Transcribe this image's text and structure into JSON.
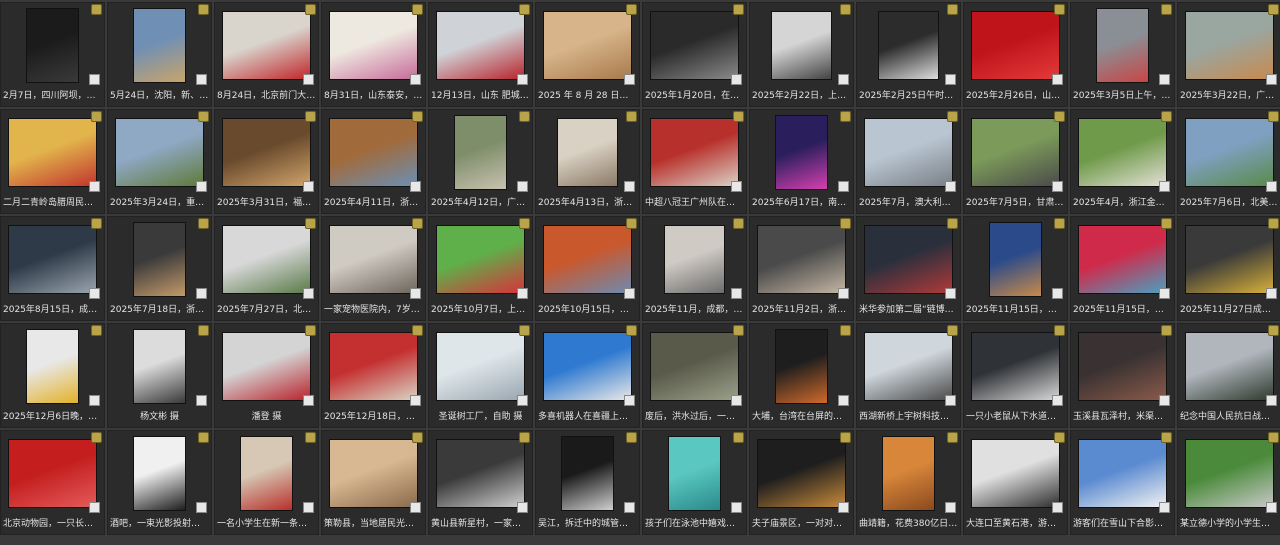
{
  "photos": [
    {
      "caption": "2月7日，四川阿坝，连绵暖…",
      "colors": [
        "#1b1b1b",
        "#3a3a3a"
      ],
      "shape": "portrait"
    },
    {
      "caption": "5月24日，沈阳，新、旧城市…",
      "colors": [
        "#6f8fb5",
        "#c9a46a"
      ],
      "shape": "portrait"
    },
    {
      "caption": "8月24日，北京前门大街，游…",
      "colors": [
        "#d9d4cc",
        "#c0262b"
      ],
      "shape": "wide"
    },
    {
      "caption": "8月31日，山东泰安，一年级…",
      "colors": [
        "#eee9e0",
        "#c76b9a"
      ],
      "shape": "wide"
    },
    {
      "caption": "12月13日，山东 肥城 爱我…",
      "colors": [
        "#cfd2d6",
        "#b8242d"
      ],
      "shape": "wide"
    },
    {
      "caption": "2025 年 8 月 28 日，中国新…",
      "colors": [
        "#d7b48a",
        "#a87a4c"
      ],
      "shape": "wide"
    },
    {
      "caption": "2025年1月20日，在上海市…",
      "colors": [
        "#2a2a2a",
        "#8a8a8a"
      ],
      "shape": "wide"
    },
    {
      "caption": "2025年2月22日，上海浦…",
      "colors": [
        "#d5d5d5",
        "#444444"
      ],
      "shape": "square"
    },
    {
      "caption": "2025年2月25日午时，重庆…",
      "colors": [
        "#2c2c2c",
        "#dcdcdc"
      ],
      "shape": "square"
    },
    {
      "caption": "2025年2月26日，山城重庆…",
      "colors": [
        "#c0141b",
        "#e33a3a"
      ],
      "shape": "wide"
    },
    {
      "caption": "2025年3月5日上午，天空下…",
      "colors": [
        "#8a8f95",
        "#c94545"
      ],
      "shape": "portrait"
    },
    {
      "caption": "2025年3月22日，广东深圳…",
      "colors": [
        "#9aa6a0",
        "#c78a4e"
      ],
      "shape": "wide"
    },
    {
      "caption": "二月二青岭岛腊周民俗大典…",
      "colors": [
        "#e2b44c",
        "#c0352d"
      ],
      "shape": "wide"
    },
    {
      "caption": "2025年3月24日，重庆市两…",
      "colors": [
        "#8fa8c4",
        "#5f7a3a"
      ],
      "shape": "wide"
    },
    {
      "caption": "2025年3月31日，福州曼谷…",
      "colors": [
        "#6a4a2d",
        "#cfa36a"
      ],
      "shape": "wide"
    },
    {
      "caption": "2025年4月11日，浙江金华…",
      "colors": [
        "#a16a3b",
        "#6c8fb4"
      ],
      "shape": "wide"
    },
    {
      "caption": "2025年4月12日，广东湛江…",
      "colors": [
        "#7e8e6a",
        "#c8c2b0"
      ],
      "shape": "portrait"
    },
    {
      "caption": "2025年4月13日，浙江义乌…",
      "colors": [
        "#d9d1c4",
        "#8c7a66"
      ],
      "shape": "square"
    },
    {
      "caption": "中超八冠王广州队在天德中…",
      "colors": [
        "#b8302b",
        "#d9d1c6"
      ],
      "shape": "wide"
    },
    {
      "caption": "2025年6月17日，南京五…",
      "colors": [
        "#2a1f5c",
        "#d63fb0"
      ],
      "shape": "portrait"
    },
    {
      "caption": "2025年7月，澳大利亚悉尼…",
      "colors": [
        "#b9c6d2",
        "#7a7f86"
      ],
      "shape": "wide"
    },
    {
      "caption": "2025年7月5日，甘肃嘉峪关…",
      "colors": [
        "#7c9a5a",
        "#4a4a4a"
      ],
      "shape": "wide"
    },
    {
      "caption": "2025年4月，浙江金华，夕…",
      "colors": [
        "#6f9a4a",
        "#e4e0d6"
      ],
      "shape": "wide"
    },
    {
      "caption": "2025年7月6日，北美山，每…",
      "colors": [
        "#7fa0c0",
        "#5a8a4a"
      ],
      "shape": "wide"
    },
    {
      "caption": "2025年8月15日，成都世界…",
      "colors": [
        "#2f3a48",
        "#9aa5b0"
      ],
      "shape": "wide"
    },
    {
      "caption": "2025年7月18日，浙江金华…",
      "colors": [
        "#3a3a3a",
        "#c49a6a"
      ],
      "shape": "portrait"
    },
    {
      "caption": "2025年7月27日，北京，暴…",
      "colors": [
        "#d8d8d8",
        "#5a7a4a"
      ],
      "shape": "wide"
    },
    {
      "caption": "一家宠物医院内，7岁的小猫…",
      "colors": [
        "#cfcac2",
        "#6e655c"
      ],
      "shape": "wide"
    },
    {
      "caption": "2025年10月7日，上海，久…",
      "colors": [
        "#5fb04a",
        "#d8323a"
      ],
      "shape": "wide"
    },
    {
      "caption": "2025年10月15日，广州三元…",
      "colors": [
        "#c9582d",
        "#6d8ab0"
      ],
      "shape": "wide"
    },
    {
      "caption": "2025年11月，成都，理发店…",
      "colors": [
        "#cfcac4",
        "#6c6c6c"
      ],
      "shape": "square"
    },
    {
      "caption": "2025年11月2日，浙江青著…",
      "colors": [
        "#4a4a4a",
        "#c4b6a4"
      ],
      "shape": "wide"
    },
    {
      "caption": "米华参加第二届“链博会”…",
      "colors": [
        "#2a2f3c",
        "#b03a3a"
      ],
      "shape": "wide"
    },
    {
      "caption": "2025年11月15日，厦门高崎…",
      "colors": [
        "#2a4a8a",
        "#c78a4a"
      ],
      "shape": "portrait"
    },
    {
      "caption": "2025年11月15日，中国重庆…",
      "colors": [
        "#d02a4a",
        "#4aa0c0"
      ],
      "shape": "wide"
    },
    {
      "caption": "2025年11月27日成都市，…",
      "colors": [
        "#3a3a3a",
        "#d8b03a"
      ],
      "shape": "wide"
    },
    {
      "caption": "2025年12月6日晚，2025-2…",
      "colors": [
        "#e8e8e8",
        "#e3b22a"
      ],
      "shape": "portrait"
    },
    {
      "caption": "杨文彬 摄",
      "colors": [
        "#dcdcdc",
        "#3a3a3a"
      ],
      "shape": "portrait"
    },
    {
      "caption": "潘登 摄",
      "colors": [
        "#d4d4d4",
        "#b8242d"
      ],
      "shape": "wide"
    },
    {
      "caption": "2025年12月18日，海口蓝三…",
      "colors": [
        "#c43030",
        "#d9d2c4"
      ],
      "shape": "wide"
    },
    {
      "caption": "圣诞树工厂，自助 摄",
      "colors": [
        "#dfe6ea",
        "#9aa6b0"
      ],
      "shape": "wide"
    },
    {
      "caption": "多喜机器人在喜疆上全流宽…",
      "colors": [
        "#2f7ad0",
        "#e8e8e8"
      ],
      "shape": "wide"
    },
    {
      "caption": "废后，洪水过后，一家养老…",
      "colors": [
        "#5a5a4a",
        "#9aa08a"
      ],
      "shape": "wide"
    },
    {
      "caption": "大埔，台湾在台屏的读中楼…",
      "colors": [
        "#1e1e1e",
        "#d06a2a"
      ],
      "shape": "portrait"
    },
    {
      "caption": "西湖新桥上宇树科技的“飞…",
      "colors": [
        "#cfd6dc",
        "#4a4a4a"
      ],
      "shape": "wide"
    },
    {
      "caption": "一只小老鼠从下水道伸出爪…",
      "colors": [
        "#2f3236",
        "#d8d8d8"
      ],
      "shape": "wide"
    },
    {
      "caption": "玉溪县瓦泽村，米渠徽妈的…",
      "colors": [
        "#3a3232",
        "#8a5a4a"
      ],
      "shape": "wide"
    },
    {
      "caption": "纪念中国人民抗日战争暨世…",
      "colors": [
        "#b0b6bc",
        "#2f3a2f"
      ],
      "shape": "wide"
    },
    {
      "caption": "北京动物园，一只长颈鹿把…",
      "colors": [
        "#c41e1e",
        "#e35b5b"
      ],
      "shape": "wide"
    },
    {
      "caption": "酒吧，一束光影投射在了身…",
      "colors": [
        "#f0f0f0",
        "#1e1e1e"
      ],
      "shape": "portrait"
    },
    {
      "caption": "一名小学生在新一条街来的…",
      "colors": [
        "#d6c8b4",
        "#b8302b"
      ],
      "shape": "portrait"
    },
    {
      "caption": "策勒县，当地居民光膀晒…",
      "colors": [
        "#d8b892",
        "#8a6a4a"
      ],
      "shape": "wide"
    },
    {
      "caption": "黄山县新星村，一家业改…",
      "colors": [
        "#3a3a3a",
        "#cfcfcf"
      ],
      "shape": "wide"
    },
    {
      "caption": "吴江，拆迁中的城管村，被…",
      "colors": [
        "#1a1a1a",
        "#cfcfcf"
      ],
      "shape": "portrait"
    },
    {
      "caption": "孩子们在泳池中嬉戏。刘 摄",
      "colors": [
        "#5ac8c0",
        "#2a8a8a"
      ],
      "shape": "portrait"
    },
    {
      "caption": "夫子庙景区，一对对游客纷…",
      "colors": [
        "#1e1e1e",
        "#c88a3a"
      ],
      "shape": "wide"
    },
    {
      "caption": "曲靖籍，花费380亿日元（…",
      "colors": [
        "#d8863a",
        "#8a4a1e"
      ],
      "shape": "portrait"
    },
    {
      "caption": "大连口至黄石港，游泳者…",
      "colors": [
        "#e0e0e0",
        "#2f2f2f"
      ],
      "shape": "wide"
    },
    {
      "caption": "游客们在雪山下合影，远处…",
      "colors": [
        "#5a8ad0",
        "#f2f2f2"
      ],
      "shape": "wide"
    },
    {
      "caption": "某立德小学的小学生在校园…",
      "colors": [
        "#4a8a3a",
        "#c8c8c8"
      ],
      "shape": "wide"
    }
  ]
}
